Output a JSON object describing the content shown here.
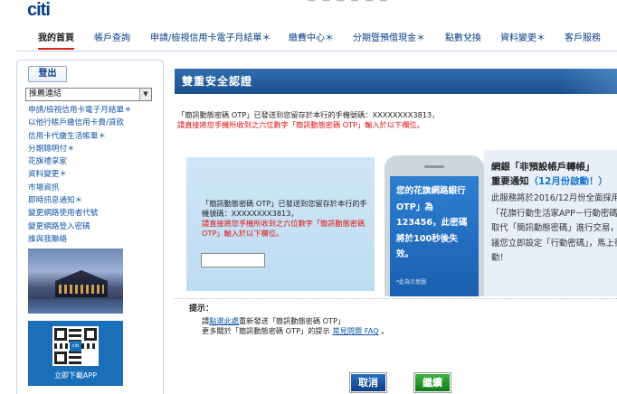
{
  "header": {
    "logo_text": "citi",
    "top_text": "— — — — — —"
  },
  "nav": [
    {
      "label": "我的首頁",
      "active": true
    },
    {
      "label": "帳戶查詢"
    },
    {
      "label": "申請/檢視信用卡電子月結單＊"
    },
    {
      "label": "繳費中心＊"
    },
    {
      "label": "分期暨預借現金＊"
    },
    {
      "label": "點數兌換"
    },
    {
      "label": "資料變更＊"
    },
    {
      "label": "客戶服務"
    }
  ],
  "sidebar": {
    "logout_label": "登出",
    "quicklink_value": "推薦連結",
    "links": [
      "申請/檢視信用卡電子月結單＊",
      "以他行帳戶繳信用卡費/貸款",
      "信用卡代繳生活帳單＊",
      "分期聰明付＊",
      "花旗禮享家",
      "資料變更＊",
      "市場資訊",
      "即時訊息通知＊",
      "變更網路使用者代號",
      "變更網路登入密碼",
      "誰與我聯絡"
    ],
    "promo_app_caption": "立即下載APP",
    "qr_logo_text": "citi"
  },
  "main": {
    "title": "雙重安全認證",
    "otp_sent_msg": "「簡訊動態密碼 OTP」已發送到您留存於本行的手機號碼：XXXXXXXX3813，",
    "otp_instruction": "請直接將您手機所收到之六位數字「簡訊動態密碼 OTP」輸入於以下欄位。",
    "box_msg": "「簡訊動態密碼 OTP」已發送到您留存於本行的手機號碼：XXXXXXXX3813，",
    "box_instruction": "請直接將您手機所收到之六位數字「簡訊動態密碼 OTP」輸入於以下欄位。",
    "otp_input_value": "",
    "phone_text": "您的花旗網路銀行OTP」為123456，此密碼將於100秒後失效。",
    "phone_note": "*此為示意圖",
    "right_heading1": "網銀「非預設帳戶轉帳」",
    "right_heading2_prefix": "重要通知",
    "right_heading2_highlight": "（12月份啟動！）",
    "right_body": "此服務將於2016/12月份全面採用「花旗行動生活家APP－行動密碼」取代「簡訊動態密碼」進行交易，建議您立即設定「行動密碼」，馬上行動！",
    "tips_label": "提示：",
    "tips_line1_pre": "請",
    "tips_line1_link": "點選此處",
    "tips_line1_post": "重新發送「簡訊動態密碼 OTP」",
    "tips_line2_pre": "更多關於「簡訊動態密碼 OTP」的提示 ",
    "tips_line2_link": "常見問題 FAQ",
    "tips_line2_post": " 。",
    "cancel_label": "取消",
    "continue_label": "繼續"
  },
  "colors": {
    "brand_blue": "#0a3f86",
    "brand_red": "#d9261c",
    "title_bar": "#1b4f8e",
    "alert_red": "#dd1111",
    "highlight_blue": "#1676d2",
    "continue_green": "#147a1a"
  }
}
